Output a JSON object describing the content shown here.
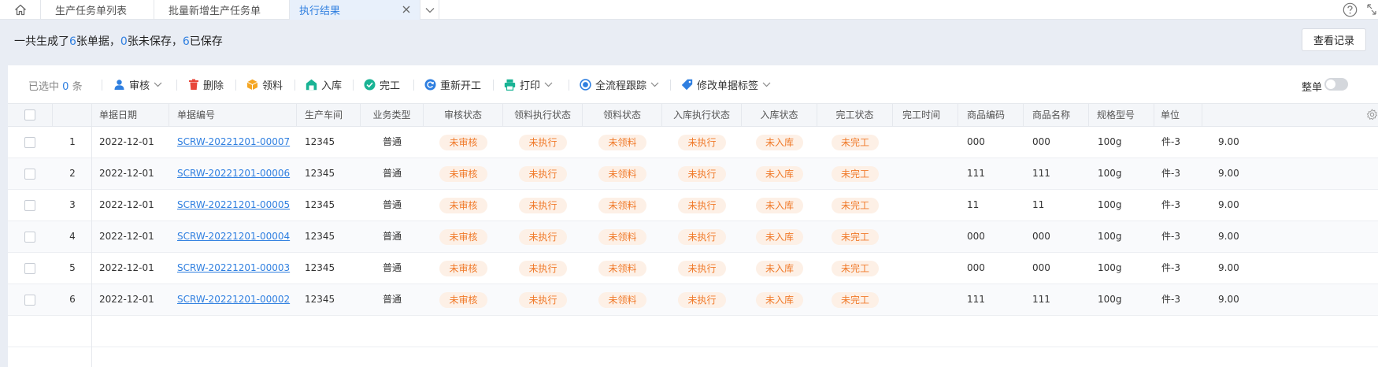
{
  "tabs": [
    {
      "label": "生产任务单列表"
    },
    {
      "label": "批量新增生产任务单"
    },
    {
      "label": "执行结果"
    }
  ],
  "summary": {
    "prefix": "一共生成了",
    "total": "6",
    "part1": "张单据，",
    "unsaved": "0",
    "part2": "张未保存，",
    "saved": "6",
    "part3": "已保存"
  },
  "record_button": "查看记录",
  "toolbar": {
    "selected_prefix": "已选中",
    "selected_count": "0",
    "selected_suffix": "条",
    "audit": "审核",
    "delete": "删除",
    "pick": "领料",
    "stock_in": "入库",
    "finish": "完工",
    "restart": "重新开工",
    "print": "打印",
    "trace": "全流程跟踪",
    "tag": "修改单据标签",
    "whole": "整单"
  },
  "columns": [
    "单据日期",
    "单据编号",
    "生产车间",
    "业务类型",
    "审核状态",
    "领料执行状态",
    "领料状态",
    "入库执行状态",
    "入库状态",
    "完工状态",
    "完工时间",
    "商品编码",
    "商品名称",
    "规格型号",
    "单位"
  ],
  "rows": [
    {
      "index": "1",
      "date": "2022-12-01",
      "code": "SCRW-20221201-00007",
      "workshop": "12345",
      "biz": "普通",
      "audit": "未审核",
      "pick_exec": "未执行",
      "pick": "未领料",
      "in_exec": "未执行",
      "in": "未入库",
      "finish": "未完工",
      "finish_time": "",
      "goods_code": "000",
      "goods_name": "000",
      "spec": "100g",
      "unit": "件-3",
      "qty": "9.00"
    },
    {
      "index": "2",
      "date": "2022-12-01",
      "code": "SCRW-20221201-00006",
      "workshop": "12345",
      "biz": "普通",
      "audit": "未审核",
      "pick_exec": "未执行",
      "pick": "未领料",
      "in_exec": "未执行",
      "in": "未入库",
      "finish": "未完工",
      "finish_time": "",
      "goods_code": "111",
      "goods_name": "111",
      "spec": "100g",
      "unit": "件-3",
      "qty": "9.00"
    },
    {
      "index": "3",
      "date": "2022-12-01",
      "code": "SCRW-20221201-00005",
      "workshop": "12345",
      "biz": "普通",
      "audit": "未审核",
      "pick_exec": "未执行",
      "pick": "未领料",
      "in_exec": "未执行",
      "in": "未入库",
      "finish": "未完工",
      "finish_time": "",
      "goods_code": "11",
      "goods_name": "11",
      "spec": "100g",
      "unit": "件-3",
      "qty": "9.00"
    },
    {
      "index": "4",
      "date": "2022-12-01",
      "code": "SCRW-20221201-00004",
      "workshop": "12345",
      "biz": "普通",
      "audit": "未审核",
      "pick_exec": "未执行",
      "pick": "未领料",
      "in_exec": "未执行",
      "in": "未入库",
      "finish": "未完工",
      "finish_time": "",
      "goods_code": "000",
      "goods_name": "000",
      "spec": "100g",
      "unit": "件-3",
      "qty": "9.00"
    },
    {
      "index": "5",
      "date": "2022-12-01",
      "code": "SCRW-20221201-00003",
      "workshop": "12345",
      "biz": "普通",
      "audit": "未审核",
      "pick_exec": "未执行",
      "pick": "未领料",
      "in_exec": "未执行",
      "in": "未入库",
      "finish": "未完工",
      "finish_time": "",
      "goods_code": "000",
      "goods_name": "000",
      "spec": "100g",
      "unit": "件-3",
      "qty": "9.00"
    },
    {
      "index": "6",
      "date": "2022-12-01",
      "code": "SCRW-20221201-00002",
      "workshop": "12345",
      "biz": "普通",
      "audit": "未审核",
      "pick_exec": "未执行",
      "pick": "未领料",
      "in_exec": "未执行",
      "in": "未入库",
      "finish": "未完工",
      "finish_time": "",
      "goods_code": "111",
      "goods_name": "111",
      "spec": "100g",
      "unit": "件-3",
      "qty": "9.00"
    }
  ],
  "colors": {
    "accent": "#2f7fe0",
    "badge_text": "#f07a2a",
    "badge_bg": "#fdf0e6"
  }
}
